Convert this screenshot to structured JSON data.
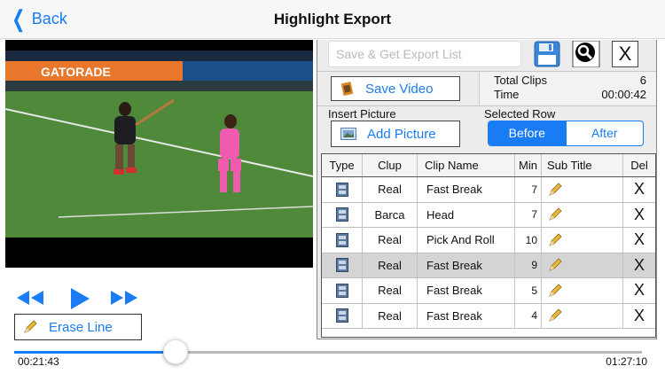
{
  "nav": {
    "back_label": "Back",
    "title": "Highlight Export"
  },
  "video": {
    "banner_text": "GATORADE"
  },
  "controls": {
    "erase_label": "Erase Line"
  },
  "timeline": {
    "current": "00:21:43",
    "total": "01:27:10",
    "progress_fraction": 0.26
  },
  "panel": {
    "search_placeholder": "Save & Get Export List",
    "close_label": "X",
    "save_video_label": "Save Video",
    "total_clips_label": "Total Clips",
    "total_clips_value": "6",
    "time_label": "Time",
    "time_value": "00:00:42",
    "insert_picture_label": "Insert Picture",
    "add_picture_label": "Add Picture",
    "selected_row_label": "Selected Row",
    "segment": {
      "before": "Before",
      "after": "After",
      "selected": "before"
    }
  },
  "table": {
    "headers": {
      "type": "Type",
      "clup": "Clup",
      "name": "Clip Name",
      "min": "Min",
      "sub": "Sub Title",
      "del": "Del"
    },
    "rows": [
      {
        "clup": "Real",
        "name": "Fast Break",
        "min": "7",
        "del": "X",
        "selected": false
      },
      {
        "clup": "Barca",
        "name": "Head",
        "min": "7",
        "del": "X",
        "selected": false
      },
      {
        "clup": "Real",
        "name": "Pick And Roll",
        "min": "10",
        "del": "X",
        "selected": false
      },
      {
        "clup": "Real",
        "name": "Fast Break",
        "min": "9",
        "del": "X",
        "selected": true
      },
      {
        "clup": "Real",
        "name": "Fast Break",
        "min": "5",
        "del": "X",
        "selected": false
      },
      {
        "clup": "Real",
        "name": "Fast Break",
        "min": "4",
        "del": "X",
        "selected": false
      }
    ]
  },
  "colors": {
    "accent": "#1a7cf5",
    "field_green": "#4f8a3a",
    "banner_orange": "#e8772b",
    "selected_row": "#d4d4d4"
  }
}
